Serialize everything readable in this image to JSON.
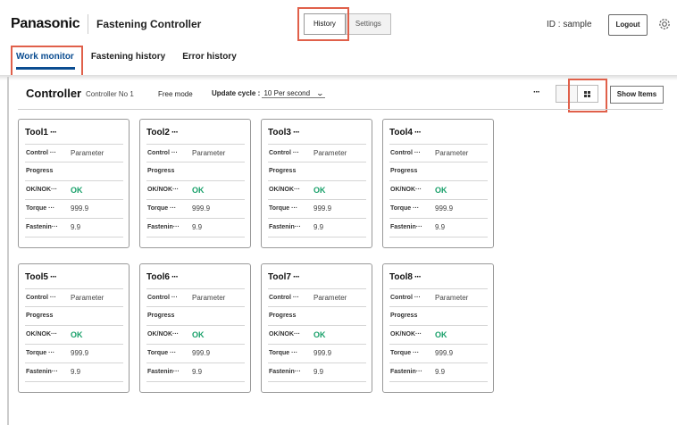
{
  "header": {
    "logo": "Panasonic",
    "app_title": "Fastening Controller",
    "tabs": [
      "History",
      "Settings"
    ],
    "user_id": "ID : sample",
    "logout_label": "Logout",
    "settings_icon": "gear-icon"
  },
  "sub_nav": {
    "tabs": [
      "Work monitor",
      "Fastening history",
      "Error history"
    ],
    "active": "Work monitor"
  },
  "controller": {
    "title": "Controller",
    "name": "Controller No 1",
    "mode": "Free mode",
    "update_label": "Update cycle :",
    "update_value": "10 Per second",
    "more": "···",
    "show_items_label": "Show Items",
    "view_icon": "grid-view-icon"
  },
  "row_labels": [
    "Control ···",
    "Progress",
    "OK/NOK···",
    "Torque ···",
    "Fastenin···"
  ],
  "tools": [
    {
      "name": "Tool1",
      "more": "···",
      "control": "Parameter",
      "progress": "",
      "ok_nok": "OK",
      "torque": "999.9",
      "fastening": "9.9"
    },
    {
      "name": "Tool2",
      "more": "···",
      "control": "Parameter",
      "progress": "",
      "ok_nok": "OK",
      "torque": "999.9",
      "fastening": "9.9"
    },
    {
      "name": "Tool3",
      "more": "···",
      "control": "Parameter",
      "progress": "",
      "ok_nok": "OK",
      "torque": "999.9",
      "fastening": "9.9"
    },
    {
      "name": "Tool4",
      "more": "···",
      "control": "Parameter",
      "progress": "",
      "ok_nok": "OK",
      "torque": "999.9",
      "fastening": "9.9"
    },
    {
      "name": "Tool5",
      "more": "···",
      "control": "Parameter",
      "progress": "",
      "ok_nok": "OK",
      "torque": "999.9",
      "fastening": "9.9"
    },
    {
      "name": "Tool6",
      "more": "···",
      "control": "Parameter",
      "progress": "",
      "ok_nok": "OK",
      "torque": "999.9",
      "fastening": "9.9"
    },
    {
      "name": "Tool7",
      "more": "···",
      "control": "Parameter",
      "progress": "",
      "ok_nok": "OK",
      "torque": "999.9",
      "fastening": "9.9"
    },
    {
      "name": "Tool8",
      "more": "···",
      "control": "Parameter",
      "progress": "",
      "ok_nok": "OK",
      "torque": "999.9",
      "fastening": "9.9"
    }
  ],
  "colors": {
    "accent": "#0b4d91",
    "highlight": "#e0604a",
    "ok": "#19a06a"
  }
}
